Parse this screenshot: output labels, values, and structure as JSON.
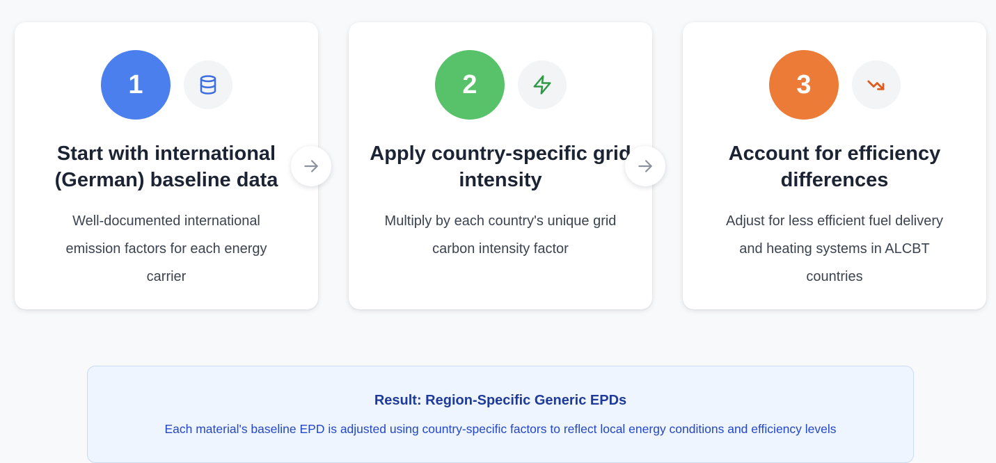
{
  "steps": [
    {
      "number": "1",
      "number_color": "#4b7fee",
      "icon": "database-icon",
      "icon_color": "#3d6ee0",
      "title": "Start with international (German) baseline data",
      "description": "Well-documented international emission factors for each energy carrier"
    },
    {
      "number": "2",
      "number_color": "#58c26a",
      "icon": "lightning-icon",
      "icon_color": "#2e9a45",
      "title": "Apply country-specific grid intensity",
      "description": "Multiply by each country's unique grid carbon intensity factor"
    },
    {
      "number": "3",
      "number_color": "#ec7b37",
      "icon": "trending-down-icon",
      "icon_color": "#dd5a1c",
      "title": "Account for efficiency differences",
      "description": "Adjust for less efficient fuel delivery and heating systems in ALCBT countries"
    }
  ],
  "connectors": [
    "arrow-right-icon",
    "arrow-right-icon"
  ],
  "result": {
    "title": "Result: Region-Specific Generic EPDs",
    "description": "Each material's baseline EPD is adjusted using country-specific factors to reflect local energy conditions and efficiency levels"
  }
}
